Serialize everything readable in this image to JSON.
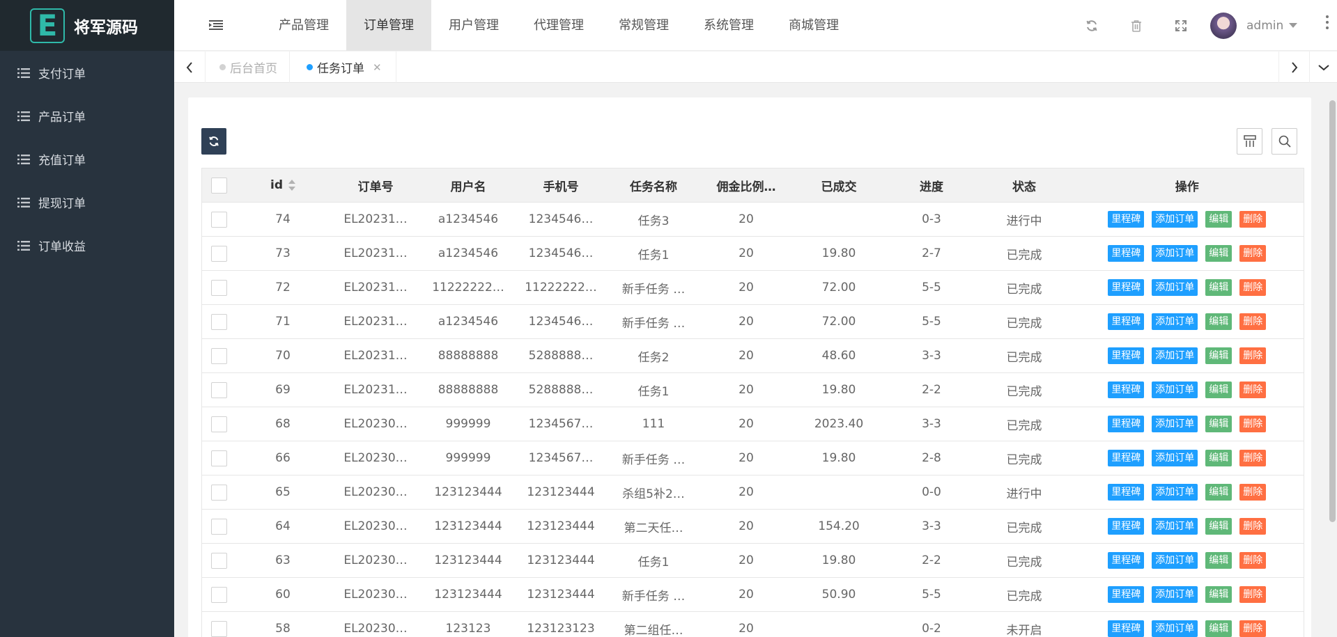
{
  "brand": {
    "logo_letter": "E",
    "name": "将军源码",
    "accent": "#2fb9a9"
  },
  "sidebar": {
    "items": [
      {
        "label": "支付订单"
      },
      {
        "label": "产品订单"
      },
      {
        "label": "充值订单"
      },
      {
        "label": "提现订单"
      },
      {
        "label": "订单收益"
      }
    ]
  },
  "topnav": {
    "tabs": [
      {
        "label": "产品管理"
      },
      {
        "label": "订单管理",
        "active": true
      },
      {
        "label": "用户管理"
      },
      {
        "label": "代理管理"
      },
      {
        "label": "常规管理"
      },
      {
        "label": "系统管理"
      },
      {
        "label": "商城管理"
      }
    ],
    "icons": [
      "refresh-icon",
      "trash-icon",
      "fullscreen-icon"
    ]
  },
  "user": {
    "name": "admin"
  },
  "page_tabs": {
    "home": "后台首页",
    "current": "任务订单"
  },
  "table": {
    "columns": [
      "id",
      "订单号",
      "用户名",
      "手机号",
      "任务名称",
      "佣金比例…",
      "已成交",
      "进度",
      "状态",
      "操作"
    ],
    "actions": {
      "milestone": "里程碑",
      "add": "添加订单",
      "edit": "编辑",
      "delete": "删除"
    },
    "rows": [
      {
        "id": "74",
        "order_no": "EL20231…",
        "username": "a1234546",
        "phone": "1234546…",
        "task": "任务3",
        "ratio": "20",
        "done": "",
        "progress": "0-3",
        "status": "进行中"
      },
      {
        "id": "73",
        "order_no": "EL20231…",
        "username": "a1234546",
        "phone": "1234546…",
        "task": "任务1",
        "ratio": "20",
        "done": "19.80",
        "progress": "2-7",
        "status": "已完成"
      },
      {
        "id": "72",
        "order_no": "EL20231…",
        "username": "11222222…",
        "phone": "11222222…",
        "task": "新手任务 …",
        "ratio": "20",
        "done": "72.00",
        "progress": "5-5",
        "status": "已完成"
      },
      {
        "id": "71",
        "order_no": "EL20231…",
        "username": "a1234546",
        "phone": "1234546…",
        "task": "新手任务 …",
        "ratio": "20",
        "done": "72.00",
        "progress": "5-5",
        "status": "已完成"
      },
      {
        "id": "70",
        "order_no": "EL20231…",
        "username": "88888888",
        "phone": "5288888…",
        "task": "任务2",
        "ratio": "20",
        "done": "48.60",
        "progress": "3-3",
        "status": "已完成"
      },
      {
        "id": "69",
        "order_no": "EL20231…",
        "username": "88888888",
        "phone": "5288888…",
        "task": "任务1",
        "ratio": "20",
        "done": "19.80",
        "progress": "2-2",
        "status": "已完成"
      },
      {
        "id": "68",
        "order_no": "EL20230…",
        "username": "999999",
        "phone": "1234567…",
        "task": "111",
        "ratio": "20",
        "done": "2023.40",
        "progress": "3-3",
        "status": "已完成"
      },
      {
        "id": "66",
        "order_no": "EL20230…",
        "username": "999999",
        "phone": "1234567…",
        "task": "新手任务 …",
        "ratio": "20",
        "done": "19.80",
        "progress": "2-8",
        "status": "已完成"
      },
      {
        "id": "65",
        "order_no": "EL20230…",
        "username": "123123444",
        "phone": "123123444",
        "task": "杀组5补2…",
        "ratio": "20",
        "done": "",
        "progress": "0-0",
        "status": "进行中"
      },
      {
        "id": "64",
        "order_no": "EL20230…",
        "username": "123123444",
        "phone": "123123444",
        "task": "第二天任…",
        "ratio": "20",
        "done": "154.20",
        "progress": "3-3",
        "status": "已完成"
      },
      {
        "id": "63",
        "order_no": "EL20230…",
        "username": "123123444",
        "phone": "123123444",
        "task": "任务1",
        "ratio": "20",
        "done": "19.80",
        "progress": "2-2",
        "status": "已完成"
      },
      {
        "id": "60",
        "order_no": "EL20230…",
        "username": "123123444",
        "phone": "123123444",
        "task": "新手任务 …",
        "ratio": "20",
        "done": "50.90",
        "progress": "5-5",
        "status": "已完成"
      },
      {
        "id": "58",
        "order_no": "EL20230…",
        "username": "123123",
        "phone": "123123123",
        "task": "第二组任…",
        "ratio": "20",
        "done": "",
        "progress": "0-2",
        "status": "未开启"
      }
    ]
  },
  "colors": {
    "sidebar_bg": "#28333e",
    "primary": "#1e9fff",
    "success": "#5fb878",
    "danger": "#ff5722",
    "dark_btn": "#2f4056"
  }
}
